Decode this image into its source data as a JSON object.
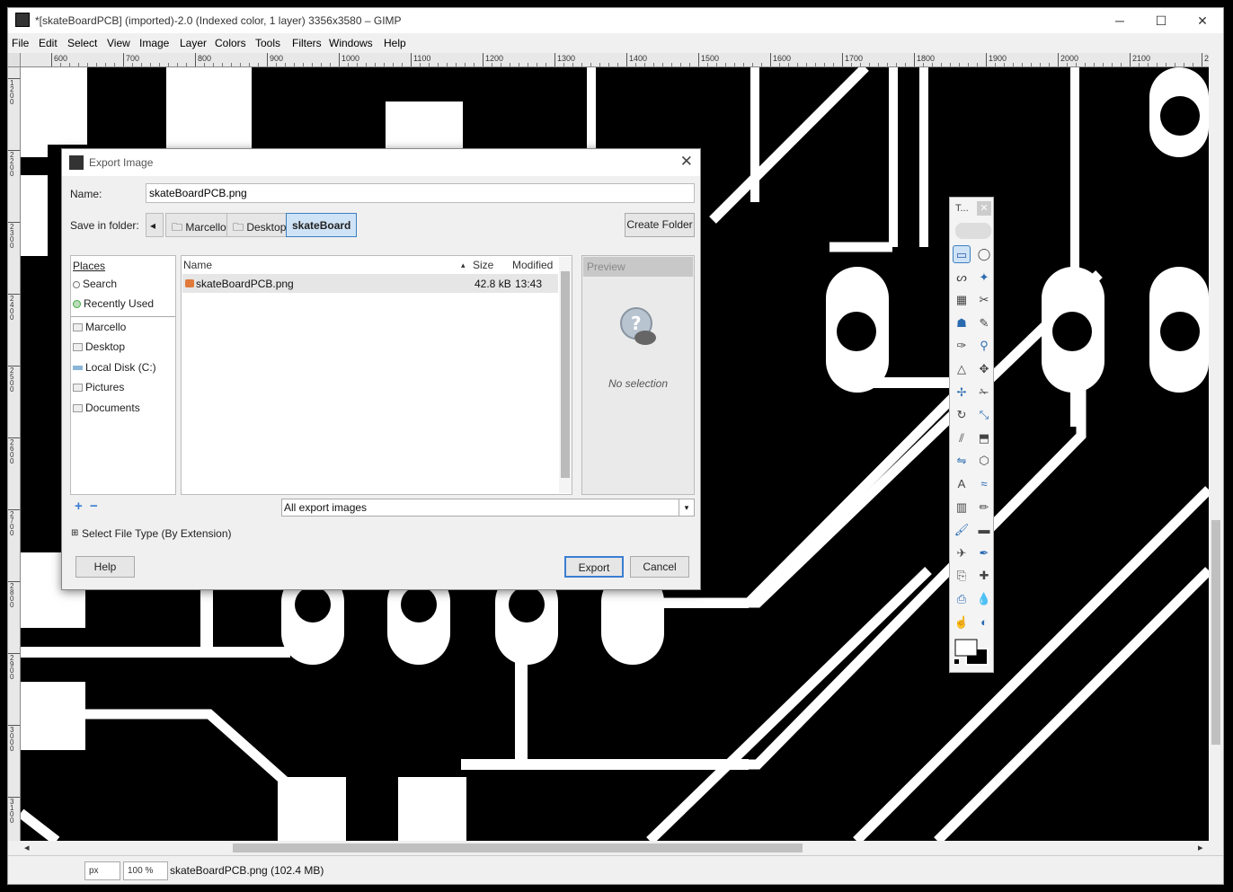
{
  "window": {
    "title": "*[skateBoardPCB] (imported)-2.0 (Indexed color, 1 layer) 3356x3580 – GIMP",
    "minimize_glyph": "─",
    "maximize_glyph": "☐",
    "close_glyph": "✕"
  },
  "menubar": [
    "File",
    "Edit",
    "Select",
    "View",
    "Image",
    "Layer",
    "Colors",
    "Tools",
    "Filters",
    "Windows",
    "Help"
  ],
  "ruler": {
    "top_labels": [
      "600",
      "700",
      "800",
      "900",
      "1000",
      "1100",
      "1200",
      "1300",
      "1400",
      "1500",
      "1600",
      "1700",
      "1800",
      "1900",
      "2000",
      "2100",
      "220"
    ],
    "left_labels": [
      "1200",
      "2200",
      "2300",
      "2400",
      "2500",
      "2600",
      "2700",
      "2800",
      "2900",
      "3000",
      "3100"
    ]
  },
  "statusbar": {
    "unit": "px",
    "zoom": "100 %",
    "image_info": "skateBoardPCB.png (102.4 MB)"
  },
  "toolbox": {
    "title": "T...",
    "close_glyph": "✕",
    "tool_icons": [
      "rect-select-icon",
      "ellipse-select-icon",
      "free-select-icon",
      "fuzzy-select-icon",
      "select-by-color-icon",
      "scissors-select-icon",
      "foreground-select-icon",
      "paths-icon",
      "color-picker-icon",
      "zoom-icon",
      "measure-icon",
      "move-icon",
      "alignment-icon",
      "crop-icon",
      "rotate-icon",
      "scale-icon",
      "shear-icon",
      "perspective-icon",
      "flip-icon",
      "cage-transform-icon",
      "text-icon",
      "warp-transform-icon",
      "blend-icon",
      "pencil-icon",
      "paintbrush-icon",
      "eraser-icon",
      "airbrush-icon",
      "ink-icon",
      "clone-icon",
      "heal-icon",
      "perspective-clone-icon",
      "blur-icon",
      "smudge-icon",
      "dodge-burn-icon"
    ]
  },
  "dialog": {
    "title": "Export Image",
    "close_glyph": "✕",
    "name_label": "Name:",
    "name_value": "skateBoardPCB.png",
    "save_in_label": "Save in folder:",
    "back_glyph": "◂",
    "breadcrumbs": [
      "Marcello",
      "Desktop",
      "skateBoard"
    ],
    "create_folder_label": "Create Folder",
    "places_header": "Places",
    "places": [
      {
        "label": "Search",
        "icon": "search-icon"
      },
      {
        "label": "Recently Used",
        "icon": "recent-icon"
      },
      {
        "label": "Marcello",
        "icon": "folder-icon"
      },
      {
        "label": "Desktop",
        "icon": "folder-icon"
      },
      {
        "label": "Local Disk (C:)",
        "icon": "drive-icon"
      },
      {
        "label": "Pictures",
        "icon": "folder-icon"
      },
      {
        "label": "Documents",
        "icon": "folder-icon"
      }
    ],
    "add_glyph": "+",
    "remove_glyph": "−",
    "columns": {
      "name": "Name",
      "sort_glyph": "▴",
      "size": "Size",
      "modified": "Modified"
    },
    "files": [
      {
        "name": "skateBoardPCB.png",
        "size": "42.8 kB",
        "modified": "13:43"
      }
    ],
    "preview_header": "Preview",
    "preview_note": "No selection",
    "filter_value": "All export images",
    "filter_arrow": "▾",
    "expander_glyph": "⊞",
    "file_type_label": "Select File Type (By Extension)",
    "help_label": "Help",
    "export_label": "Export",
    "cancel_label": "Cancel"
  },
  "colors": {
    "pcb_black": "#000000",
    "pcb_copper": "#ffffff",
    "accent": "#3a7ed2"
  }
}
